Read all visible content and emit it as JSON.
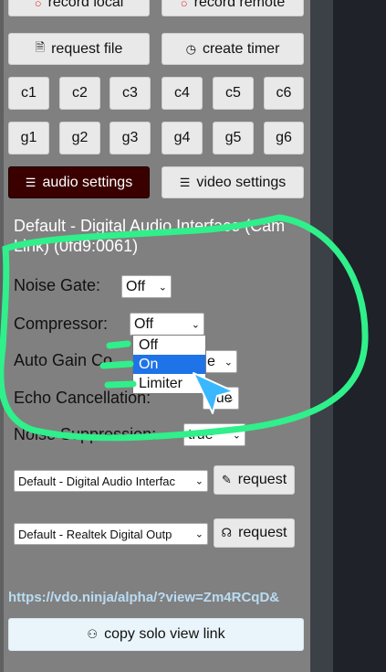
{
  "record_buttons": {
    "local": "record local",
    "remote": "record remote"
  },
  "actions": {
    "request_file": "request file",
    "create_timer": "create timer"
  },
  "c_buttons": [
    "c1",
    "c2",
    "c3",
    "c4",
    "c5",
    "c6"
  ],
  "g_buttons": [
    "g1",
    "g2",
    "g3",
    "g4",
    "g5",
    "g6"
  ],
  "tabs": {
    "audio": "audio settings",
    "video": "video settings"
  },
  "device_title": "Default - Digital Audio Interface (Cam Link) (0fd9:0061)",
  "settings": {
    "noise_gate": {
      "label": "Noise Gate:",
      "value": "Off"
    },
    "compressor": {
      "label": "Compressor:",
      "value": "Off"
    },
    "auto_gain": {
      "label": "Auto Gain Co",
      "value": "e"
    },
    "echo_cancellation": {
      "label": "Echo Cancellation:",
      "value": "true"
    },
    "noise_suppression": {
      "label": "Noise Suppression:",
      "value": "true"
    }
  },
  "compressor_options": [
    "Off",
    "On",
    "Limiter"
  ],
  "compressor_highlighted": "On",
  "input_device": {
    "value": "Default - Digital Audio Interfac",
    "request": "request"
  },
  "output_device": {
    "value": "Default - Realtek Digital Outp",
    "request": "request"
  },
  "solo_link": "https://vdo.ninja/alpha/?view=Zm4RCqD&",
  "copy_link": "copy solo view link",
  "annotation_color": "#2ff08a"
}
